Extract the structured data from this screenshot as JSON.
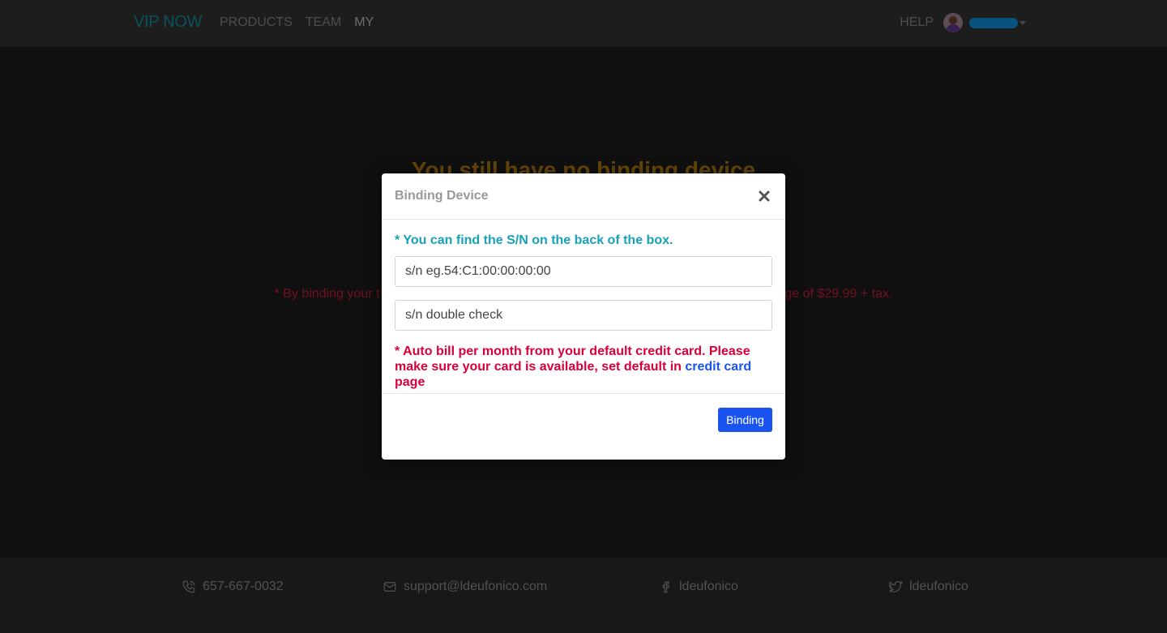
{
  "navbar": {
    "brand": "VIP NOW",
    "links": [
      {
        "label": "PRODUCTS"
      },
      {
        "label": "TEAM"
      },
      {
        "label": "MY"
      }
    ],
    "help_label": "HELP"
  },
  "main": {
    "title": "You still have no binding device",
    "note_left": "* By binding your t",
    "note_right": "ge of $29.99 + tax."
  },
  "footer": {
    "phone": "657-667-0032",
    "email": "support@ldeufonico.com",
    "facebook": "ldeufonico",
    "twitter": "ldeufonico"
  },
  "modal": {
    "title": "Binding Device",
    "hint": "* You can find the S/N on the back of the box.",
    "sn_placeholder": "s/n eg.54:C1:00:00:00:00",
    "sn_check_placeholder": "s/n double check",
    "bill_note_prefix": "* Auto bill per month from your default credit card. Please make sure your card is available, set default in ",
    "bill_note_link": "credit card",
    "bill_note_suffix": " page",
    "button_label": "Binding"
  },
  "colors": {
    "brand": "#17a2b8",
    "primary": "#1a54f0",
    "danger": "#d9003a",
    "title": "#c98a12"
  }
}
